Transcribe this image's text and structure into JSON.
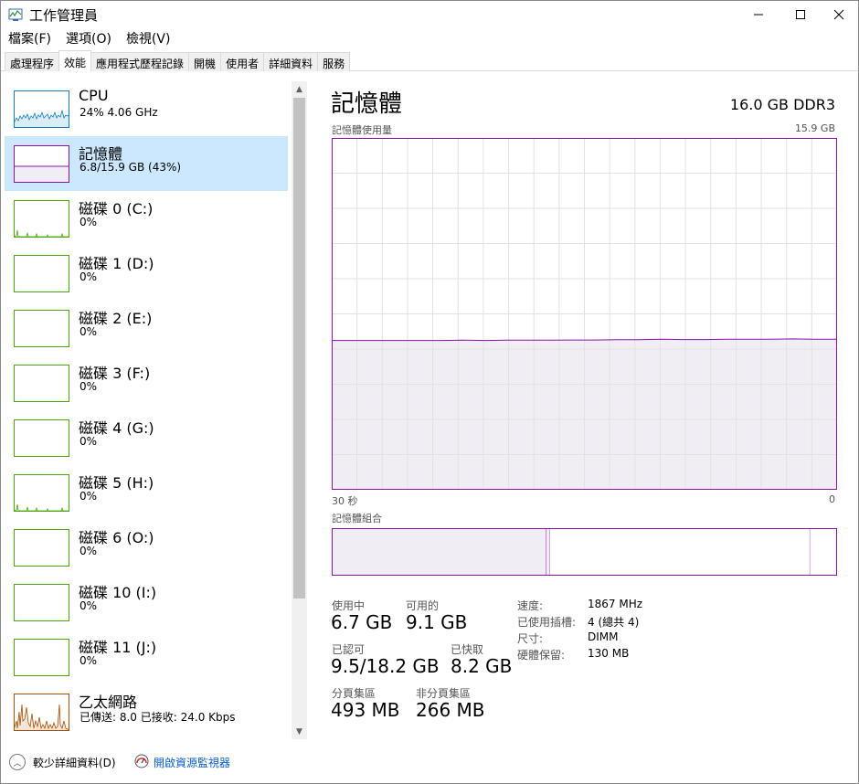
{
  "window": {
    "title": "工作管理員",
    "minimize": "—",
    "maximize": "☐",
    "close": "✕"
  },
  "menu": [
    "檔案(F)",
    "選項(O)",
    "檢視(V)"
  ],
  "tabs": [
    "處理程序",
    "效能",
    "應用程式歷程記錄",
    "開機",
    "使用者",
    "詳細資料",
    "服務"
  ],
  "active_tab": "效能",
  "sidebar": [
    {
      "name": "CPU",
      "sub": "24%  4.06 GHz",
      "kind": "cpu"
    },
    {
      "name": "記憶體",
      "sub": "6.8/15.9 GB (43%)",
      "kind": "memory"
    },
    {
      "name": "磁碟 0 (C:)",
      "sub": "0%",
      "kind": "disk"
    },
    {
      "name": "磁碟 1 (D:)",
      "sub": "0%",
      "kind": "disk"
    },
    {
      "name": "磁碟 2 (E:)",
      "sub": "0%",
      "kind": "disk"
    },
    {
      "name": "磁碟 3 (F:)",
      "sub": "0%",
      "kind": "disk"
    },
    {
      "name": "磁碟 4 (G:)",
      "sub": "0%",
      "kind": "disk"
    },
    {
      "name": "磁碟 5 (H:)",
      "sub": "0%",
      "kind": "disk"
    },
    {
      "name": "磁碟 6 (O:)",
      "sub": "0%",
      "kind": "disk"
    },
    {
      "name": "磁碟 10 (I:)",
      "sub": "0%",
      "kind": "disk"
    },
    {
      "name": "磁碟 11 (J:)",
      "sub": "0%",
      "kind": "disk"
    },
    {
      "name": "乙太網路",
      "sub": "已傳送: 8.0 已接收: 24.0 Kbps",
      "kind": "net"
    }
  ],
  "selected_index": 1,
  "colors": {
    "memory": "#8b12ae",
    "memory_fill": "#f1edf4",
    "disk": "#4da60c",
    "cpu": "#117dbb",
    "net": "#a74f01",
    "grid": "#e2e2e2",
    "link": "#0b5ec9",
    "selected_bg": "#cce8ff"
  },
  "main": {
    "title": "記憶體",
    "spec": "16.0 GB DDR3",
    "usage_label": "記憶體使用量",
    "usage_max": "15.9 GB",
    "time_left": "30 秒",
    "time_right": "0",
    "composition_label": "記憶體組合"
  },
  "usage_graph": {
    "max_gb": 15.9,
    "values_gb": [
      6.75,
      6.75,
      6.75,
      6.75,
      6.75,
      6.75,
      6.76,
      6.75,
      6.76,
      6.76,
      6.76,
      6.77,
      6.77,
      6.78,
      6.78,
      6.8,
      6.79,
      6.79,
      6.8,
      6.8,
      6.8,
      6.82,
      6.8,
      6.8
    ]
  },
  "composition": {
    "in_use": 0.425,
    "modified": 0.006,
    "standby": 0.515,
    "free": 0.054
  },
  "stats": {
    "in_use_label": "使用中",
    "in_use": "6.7 GB",
    "available_label": "可用的",
    "available": "9.1 GB",
    "committed_label": "已認可",
    "committed": "9.5/18.2 GB",
    "cached_label": "已快取",
    "cached": "8.2 GB",
    "paged_label": "分頁集區",
    "paged": "493 MB",
    "nonpaged_label": "非分頁集區",
    "nonpaged": "266 MB"
  },
  "details": [
    {
      "key": "速度:",
      "value": "1867 MHz"
    },
    {
      "key": "已使用插槽:",
      "value": "4 (總共 4)"
    },
    {
      "key": "尺寸:",
      "value": "DIMM"
    },
    {
      "key": "硬體保留:",
      "value": "130 MB"
    }
  ],
  "footer": {
    "fewer_details": "較少詳細資料(D)",
    "resource_monitor": "開啟資源監視器"
  }
}
